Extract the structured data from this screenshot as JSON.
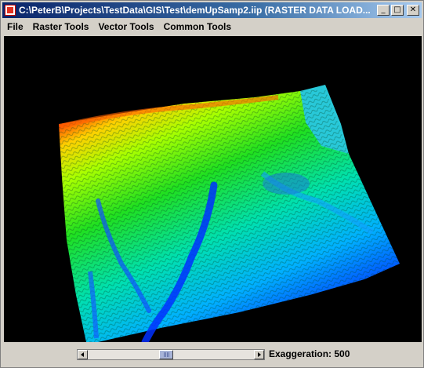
{
  "window": {
    "title": "C:\\PeterB\\Projects\\TestData\\GIS\\Test\\demUpSamp2.iip  (RASTER DATA LOAD...",
    "minimize_glyph": "_",
    "maximize_glyph": "□",
    "close_glyph": "✕"
  },
  "menu": {
    "items": [
      {
        "label": "File"
      },
      {
        "label": "Raster Tools"
      },
      {
        "label": "Vector Tools"
      },
      {
        "label": "Common Tools"
      }
    ]
  },
  "viewport": {
    "content": "3D terrain rendering",
    "background": "#000000",
    "colormap": [
      "#0000ff",
      "#00ffff",
      "#00ff00",
      "#ffff00",
      "#ff0000"
    ]
  },
  "exaggeration": {
    "label": "Exaggeration: 500",
    "slider_fraction": 0.47
  }
}
